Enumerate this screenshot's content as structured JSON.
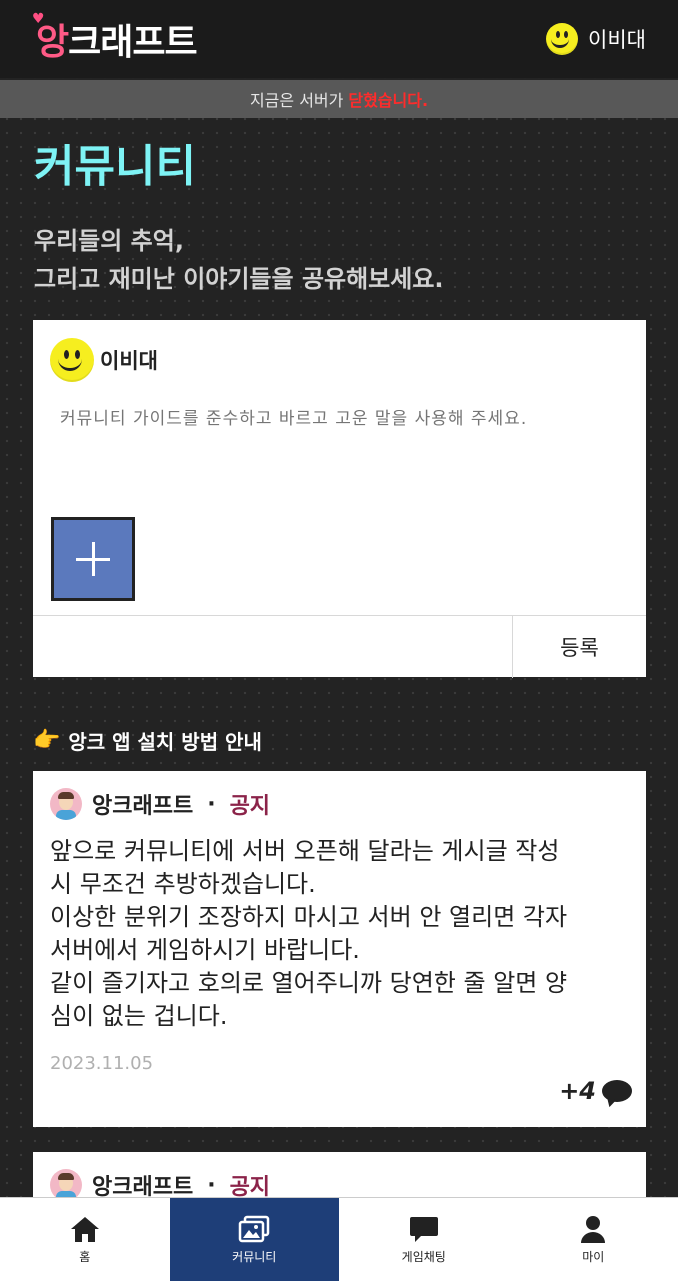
{
  "header": {
    "logo_first": "앙",
    "logo_rest": "크래프트",
    "username": "이비대"
  },
  "status": {
    "prefix": "지금은 서버가 ",
    "state": "닫혔습니다."
  },
  "page": {
    "title": "커뮤니티",
    "subtitle_line1": "우리들의 추억,",
    "subtitle_line2": "그리고 재미난 이야기들을 공유해보세요."
  },
  "composer": {
    "author": "이비대",
    "placeholder": "커뮤니티 가이드를 준수하고 바르고 고운 말을 사용해 주세요.",
    "submit_label": "등록"
  },
  "guide": {
    "label": "앙크 앱 설치 방법 안내"
  },
  "posts": [
    {
      "author": "앙크래프트",
      "tag": "공지",
      "body_lines": [
        "앞으로 커뮤니티에 서버 오픈해 달라는 게시글 작성",
        "시 무조건 추방하겠습니다.",
        "이상한 분위기 조장하지 마시고 서버 안 열리면 각자",
        "서버에서 게임하시기 바랍니다.",
        "같이 즐기자고 호의로 열어주니까 당연한 줄 알면 양",
        "심이 없는 겁니다."
      ],
      "date": "2023.11.05",
      "comment_count": "+4"
    },
    {
      "author": "앙크래프트",
      "tag": "공지"
    }
  ],
  "nav": [
    {
      "label": "홈",
      "icon": "home-icon"
    },
    {
      "label": "커뮤니티",
      "icon": "gallery-icon",
      "active": true
    },
    {
      "label": "게임채팅",
      "icon": "chat-icon"
    },
    {
      "label": "마이",
      "icon": "person-icon"
    }
  ],
  "colors": {
    "title_accent": "#7ef3f5",
    "status_closed": "#ff2b2b",
    "notice_tag": "#8b2349",
    "nav_active": "#1e3e78",
    "add_button": "#5b79bd"
  }
}
